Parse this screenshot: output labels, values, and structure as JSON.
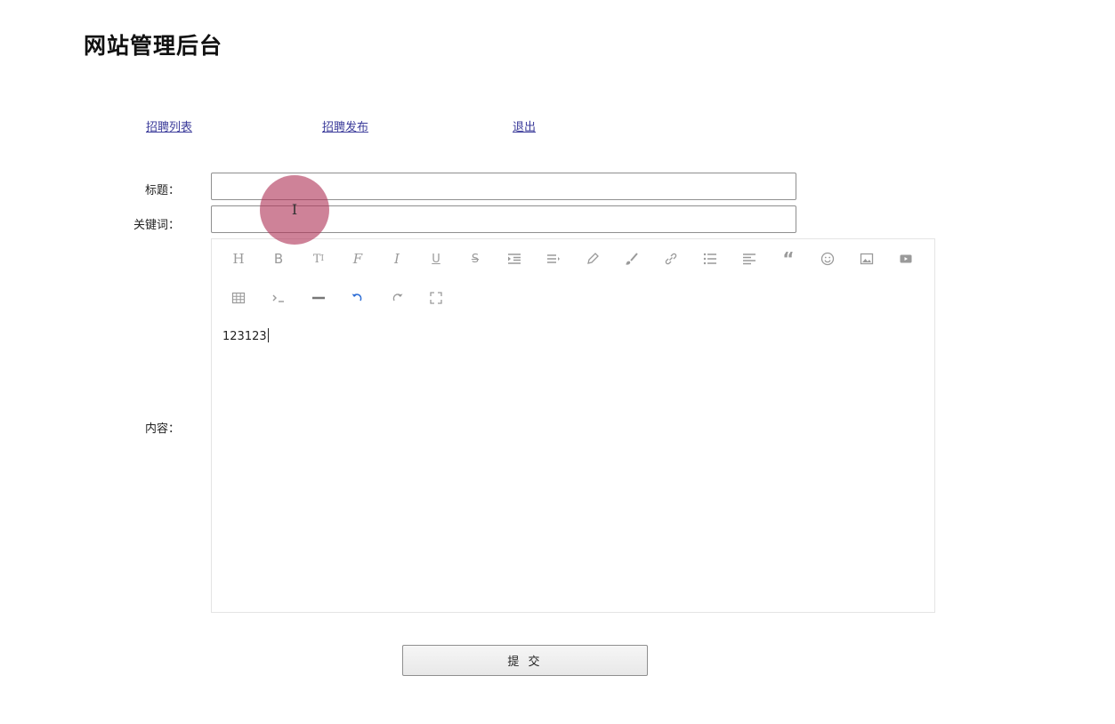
{
  "header": {
    "title": "网站管理后台"
  },
  "nav": {
    "list": "招聘列表",
    "publish": "招聘发布",
    "logout": "退出"
  },
  "form": {
    "title_label": "标题：",
    "title_value": "",
    "keywords_label": "关键词：",
    "keywords_value": "",
    "content_label": "内容：",
    "content_value": "123123",
    "submit_label": "提 交"
  },
  "editor": {
    "toolbar": [
      "heading",
      "bold",
      "font-size",
      "font-family",
      "italic",
      "underline",
      "strikethrough",
      "indent",
      "line-height",
      "font-color",
      "background-color",
      "link",
      "unordered-list",
      "justify",
      "quote",
      "emoticon",
      "image",
      "video",
      "table",
      "code",
      "divider",
      "undo",
      "redo",
      "fullscreen"
    ],
    "active_color": "#2f6fd6"
  },
  "cursor": {
    "icon": "i-beam-cursor-icon",
    "highlight_color": "#b03658"
  }
}
